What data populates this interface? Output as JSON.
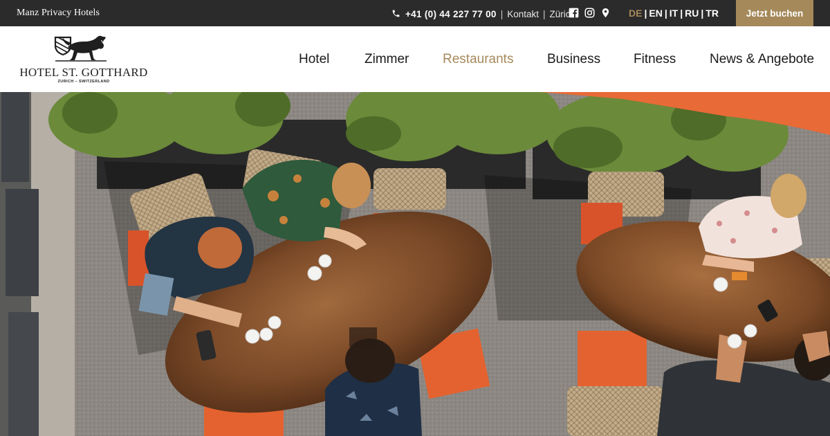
{
  "topbar": {
    "brand": "Manz Privacy Hotels",
    "phone": "+41 (0) 44 227 77 00",
    "contact_label": "Kontakt",
    "city_label": "Zürich",
    "separator": "|",
    "social_icons": [
      "facebook-icon",
      "instagram-icon",
      "map-pin-icon"
    ],
    "languages": [
      {
        "code": "DE",
        "active": true
      },
      {
        "code": "EN",
        "active": false
      },
      {
        "code": "IT",
        "active": false
      },
      {
        "code": "RU",
        "active": false
      },
      {
        "code": "TR",
        "active": false
      }
    ],
    "book_label": "Jetzt buchen"
  },
  "logo": {
    "name": "HOTEL ST. GOTTHARD",
    "subtitle": "ZURICH – SWITZERLAND"
  },
  "nav": {
    "items": [
      {
        "label": "Hotel"
      },
      {
        "label": "Zimmer"
      },
      {
        "label": "Restaurants",
        "active": true
      },
      {
        "label": "Business"
      },
      {
        "label": "Fitness"
      },
      {
        "label": "News & Angebote"
      }
    ]
  },
  "colors": {
    "accent": "#a5895a",
    "topbar_bg": "#2b2b2b",
    "text": "#1a1a1a"
  }
}
